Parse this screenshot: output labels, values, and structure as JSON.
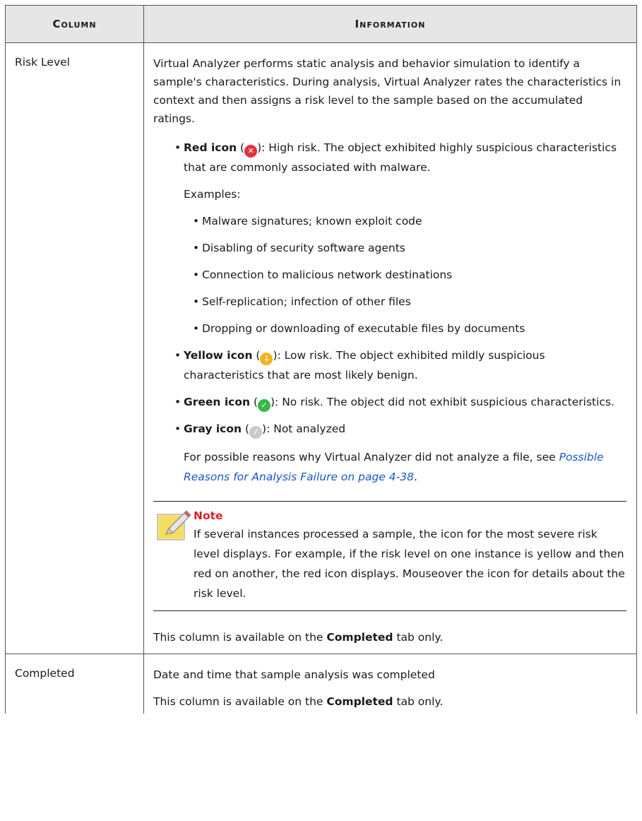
{
  "header": {
    "col1": "Column",
    "col2": "Information"
  },
  "rows": {
    "risk": {
      "name": "Risk Level",
      "intro": "Virtual Analyzer performs static analysis and behavior simulation to identify a sample's characteristics. During analysis, Virtual Analyzer rates the characteristics in context and then assigns a risk level to the sample based on the accumulated ratings.",
      "red": {
        "label": "Red icon",
        "open": " (",
        "close": "): High risk. The object exhibited highly suspicious characteristics that are commonly associated with malware."
      },
      "examples_label": "Examples:",
      "examples": [
        "Malware signatures; known exploit code",
        "Disabling of security software agents",
        "Connection to malicious network destinations",
        "Self-replication; infection of other files",
        "Dropping or downloading of executable files by documents"
      ],
      "yellow": {
        "label": "Yellow icon",
        "open": " (",
        "close": "): Low risk. The object exhibited mildly suspicious characteristics that are most likely benign."
      },
      "green": {
        "label": "Green icon",
        "open": " (",
        "close": "): No risk. The object did not exhibit suspicious characteristics."
      },
      "gray": {
        "label": "Gray icon",
        "open": " (",
        "close": "): Not analyzed"
      },
      "reasons_text": "For possible reasons why Virtual Analyzer did not analyze a file, see ",
      "reasons_link": "Possible Reasons for Analysis Failure on page 4-38",
      "reasons_end": ".",
      "note_title": "Note",
      "note_text": "If several instances processed a sample, the icon for the most severe risk level displays. For example, if the risk level on one instance is yellow and then red on another, the red icon displays. Mouseover the icon for details about the risk level.",
      "avail_pre": "This column is available on the ",
      "avail_bold": "Completed",
      "avail_post": " tab only."
    },
    "completed": {
      "name": "Completed",
      "desc": "Date and time that sample analysis was completed",
      "avail_pre": "This column is available on the ",
      "avail_bold": "Completed",
      "avail_post": " tab only."
    }
  },
  "icons": {
    "red": "#e0323a",
    "yellow": "#f5b31b",
    "green": "#39b54a",
    "gray": "#c9c9c9",
    "link": "#1a56c7",
    "note_title": "#d8232a"
  }
}
